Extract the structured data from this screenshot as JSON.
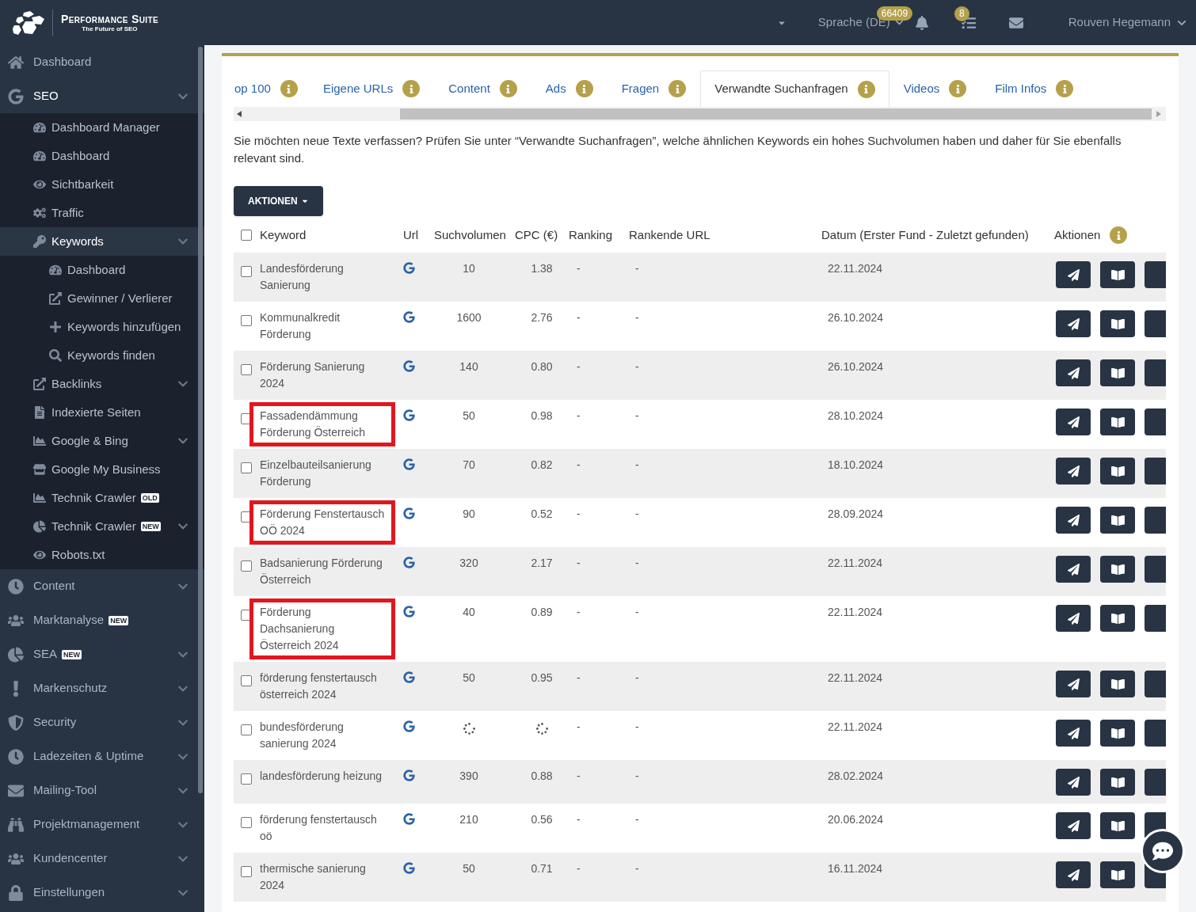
{
  "header": {
    "logo_title": "Performance Suite",
    "logo_subtitle": "The Future of SEO",
    "language": "Sprache (DE)",
    "notifications_badge": "66409",
    "tasks_badge": "8",
    "user": "Rouven Hegemann"
  },
  "sidebar": {
    "items": [
      {
        "label": "Dashboard",
        "expandable": false,
        "selected": false
      },
      {
        "label": "SEO",
        "expandable": true,
        "selected": true,
        "children": [
          {
            "label": "Dashboard Manager",
            "expandable": false,
            "selected": false
          },
          {
            "label": "Dashboard",
            "expandable": false,
            "selected": false
          },
          {
            "label": "Sichtbarkeit",
            "expandable": false,
            "selected": false
          },
          {
            "label": "Traffic",
            "expandable": false,
            "selected": false
          },
          {
            "label": "Keywords",
            "expandable": true,
            "selected": true,
            "children": [
              {
                "label": "Dashboard",
                "expandable": false,
                "selected": false
              },
              {
                "label": "Gewinner / Verlierer",
                "expandable": false,
                "selected": false
              },
              {
                "label": "Keywords hinzufügen",
                "expandable": false,
                "selected": false
              },
              {
                "label": "Keywords finden",
                "expandable": false,
                "selected": false
              }
            ]
          },
          {
            "label": "Backlinks",
            "expandable": true,
            "selected": false
          },
          {
            "label": "Indexierte Seiten",
            "expandable": false,
            "selected": false
          },
          {
            "label": "Google & Bing",
            "expandable": true,
            "selected": false
          },
          {
            "label": "Google My Business",
            "expandable": false,
            "selected": false
          },
          {
            "label": "Technik Crawler",
            "badge": "OLD",
            "expandable": false,
            "selected": false
          },
          {
            "label": "Technik Crawler",
            "badge": "NEW",
            "expandable": true,
            "selected": false
          },
          {
            "label": "Robots.txt",
            "expandable": false,
            "selected": false
          }
        ]
      },
      {
        "label": "Content",
        "expandable": true,
        "selected": false
      },
      {
        "label": "Marktanalyse",
        "badge": "NEW",
        "expandable": false,
        "selected": false
      },
      {
        "label": "SEA",
        "badge": "NEW",
        "expandable": true,
        "selected": false
      },
      {
        "label": "Markenschutz",
        "expandable": true,
        "selected": false
      },
      {
        "label": "Security",
        "expandable": true,
        "selected": false
      },
      {
        "label": "Ladezeiten & Uptime",
        "expandable": true,
        "selected": false
      },
      {
        "label": "Mailing-Tool",
        "expandable": true,
        "selected": false
      },
      {
        "label": "Projektmanagement",
        "expandable": true,
        "selected": false
      },
      {
        "label": "Kundencenter",
        "expandable": true,
        "selected": false
      },
      {
        "label": "Einstellungen",
        "expandable": true,
        "selected": false
      }
    ]
  },
  "tabs": [
    {
      "label": "op 100",
      "selected": false
    },
    {
      "label": "Eigene URLs",
      "selected": false
    },
    {
      "label": "Content",
      "selected": false
    },
    {
      "label": "Ads",
      "selected": false
    },
    {
      "label": "Fragen",
      "selected": false
    },
    {
      "label": "Verwandte Suchanfragen",
      "selected": true
    },
    {
      "label": "Videos",
      "selected": false
    },
    {
      "label": "Film Infos",
      "selected": false
    }
  ],
  "description": "Sie möchten neue Texte verfassen? Prüfen Sie unter “Verwandte Suchanfragen”, welche ähnlichen Keywords ein hohes Suchvolumen haben und daher für Sie ebenfalls relevant sind.",
  "actions_button": "AKTIONEN",
  "table": {
    "select_all_checked": false,
    "columns": [
      "Keyword",
      "Url",
      "Suchvolumen",
      "CPC (€)",
      "Ranking",
      "Rankende URL",
      "Datum (Erster Fund - Zuletzt gefunden)",
      "Aktionen"
    ],
    "rows": [
      {
        "keyword": "Landesförderung Sanierung",
        "volume": "10",
        "cpc": "1.38",
        "ranking": "-",
        "ranking_url": "-",
        "date": "22.11.2024",
        "checked": false,
        "loading": false,
        "highlighted": false
      },
      {
        "keyword": "Kommunalkredit Förderung",
        "volume": "1600",
        "cpc": "2.76",
        "ranking": "-",
        "ranking_url": "-",
        "date": "26.10.2024",
        "checked": false,
        "loading": false,
        "highlighted": false
      },
      {
        "keyword": "Förderung Sanierung 2024",
        "volume": "140",
        "cpc": "0.80",
        "ranking": "-",
        "ranking_url": "-",
        "date": "26.10.2024",
        "checked": false,
        "loading": false,
        "highlighted": false
      },
      {
        "keyword": "Fassadendämmung Förderung Österreich",
        "volume": "50",
        "cpc": "0.98",
        "ranking": "-",
        "ranking_url": "-",
        "date": "28.10.2024",
        "checked": false,
        "loading": false,
        "highlighted": true
      },
      {
        "keyword": "Einzelbauteilsanierung Förderung",
        "volume": "70",
        "cpc": "0.82",
        "ranking": "-",
        "ranking_url": "-",
        "date": "18.10.2024",
        "checked": false,
        "loading": false,
        "highlighted": false
      },
      {
        "keyword": "Förderung Fenstertausch OÖ 2024",
        "volume": "90",
        "cpc": "0.52",
        "ranking": "-",
        "ranking_url": "-",
        "date": "28.09.2024",
        "checked": false,
        "loading": false,
        "highlighted": true
      },
      {
        "keyword": "Badsanierung Förderung Österreich",
        "volume": "320",
        "cpc": "2.17",
        "ranking": "-",
        "ranking_url": "-",
        "date": "22.11.2024",
        "checked": false,
        "loading": false,
        "highlighted": false
      },
      {
        "keyword": "Förderung Dachsanierung Österreich 2024",
        "volume": "40",
        "cpc": "0.89",
        "ranking": "-",
        "ranking_url": "-",
        "date": "22.11.2024",
        "checked": false,
        "loading": false,
        "highlighted": true
      },
      {
        "keyword": "förderung fenstertausch österreich 2024",
        "volume": "50",
        "cpc": "0.95",
        "ranking": "-",
        "ranking_url": "-",
        "date": "22.11.2024",
        "checked": false,
        "loading": false,
        "highlighted": false
      },
      {
        "keyword": "bundesförderung sanierung 2024",
        "ranking": "-",
        "ranking_url": "-",
        "date": "22.11.2024",
        "checked": false,
        "loading": true,
        "highlighted": false
      },
      {
        "keyword": "landesförderung heizung",
        "volume": "390",
        "cpc": "0.88",
        "ranking": "-",
        "ranking_url": "-",
        "date": "28.02.2024",
        "checked": false,
        "loading": false,
        "highlighted": false
      },
      {
        "keyword": "förderung fenstertausch oö",
        "volume": "210",
        "cpc": "0.56",
        "ranking": "-",
        "ranking_url": "-",
        "date": "20.06.2024",
        "checked": false,
        "loading": false,
        "highlighted": false
      },
      {
        "keyword": "thermische sanierung 2024",
        "volume": "50",
        "cpc": "0.71",
        "ranking": "-",
        "ranking_url": "-",
        "date": "16.11.2024",
        "checked": false,
        "loading": false,
        "highlighted": false
      }
    ]
  }
}
